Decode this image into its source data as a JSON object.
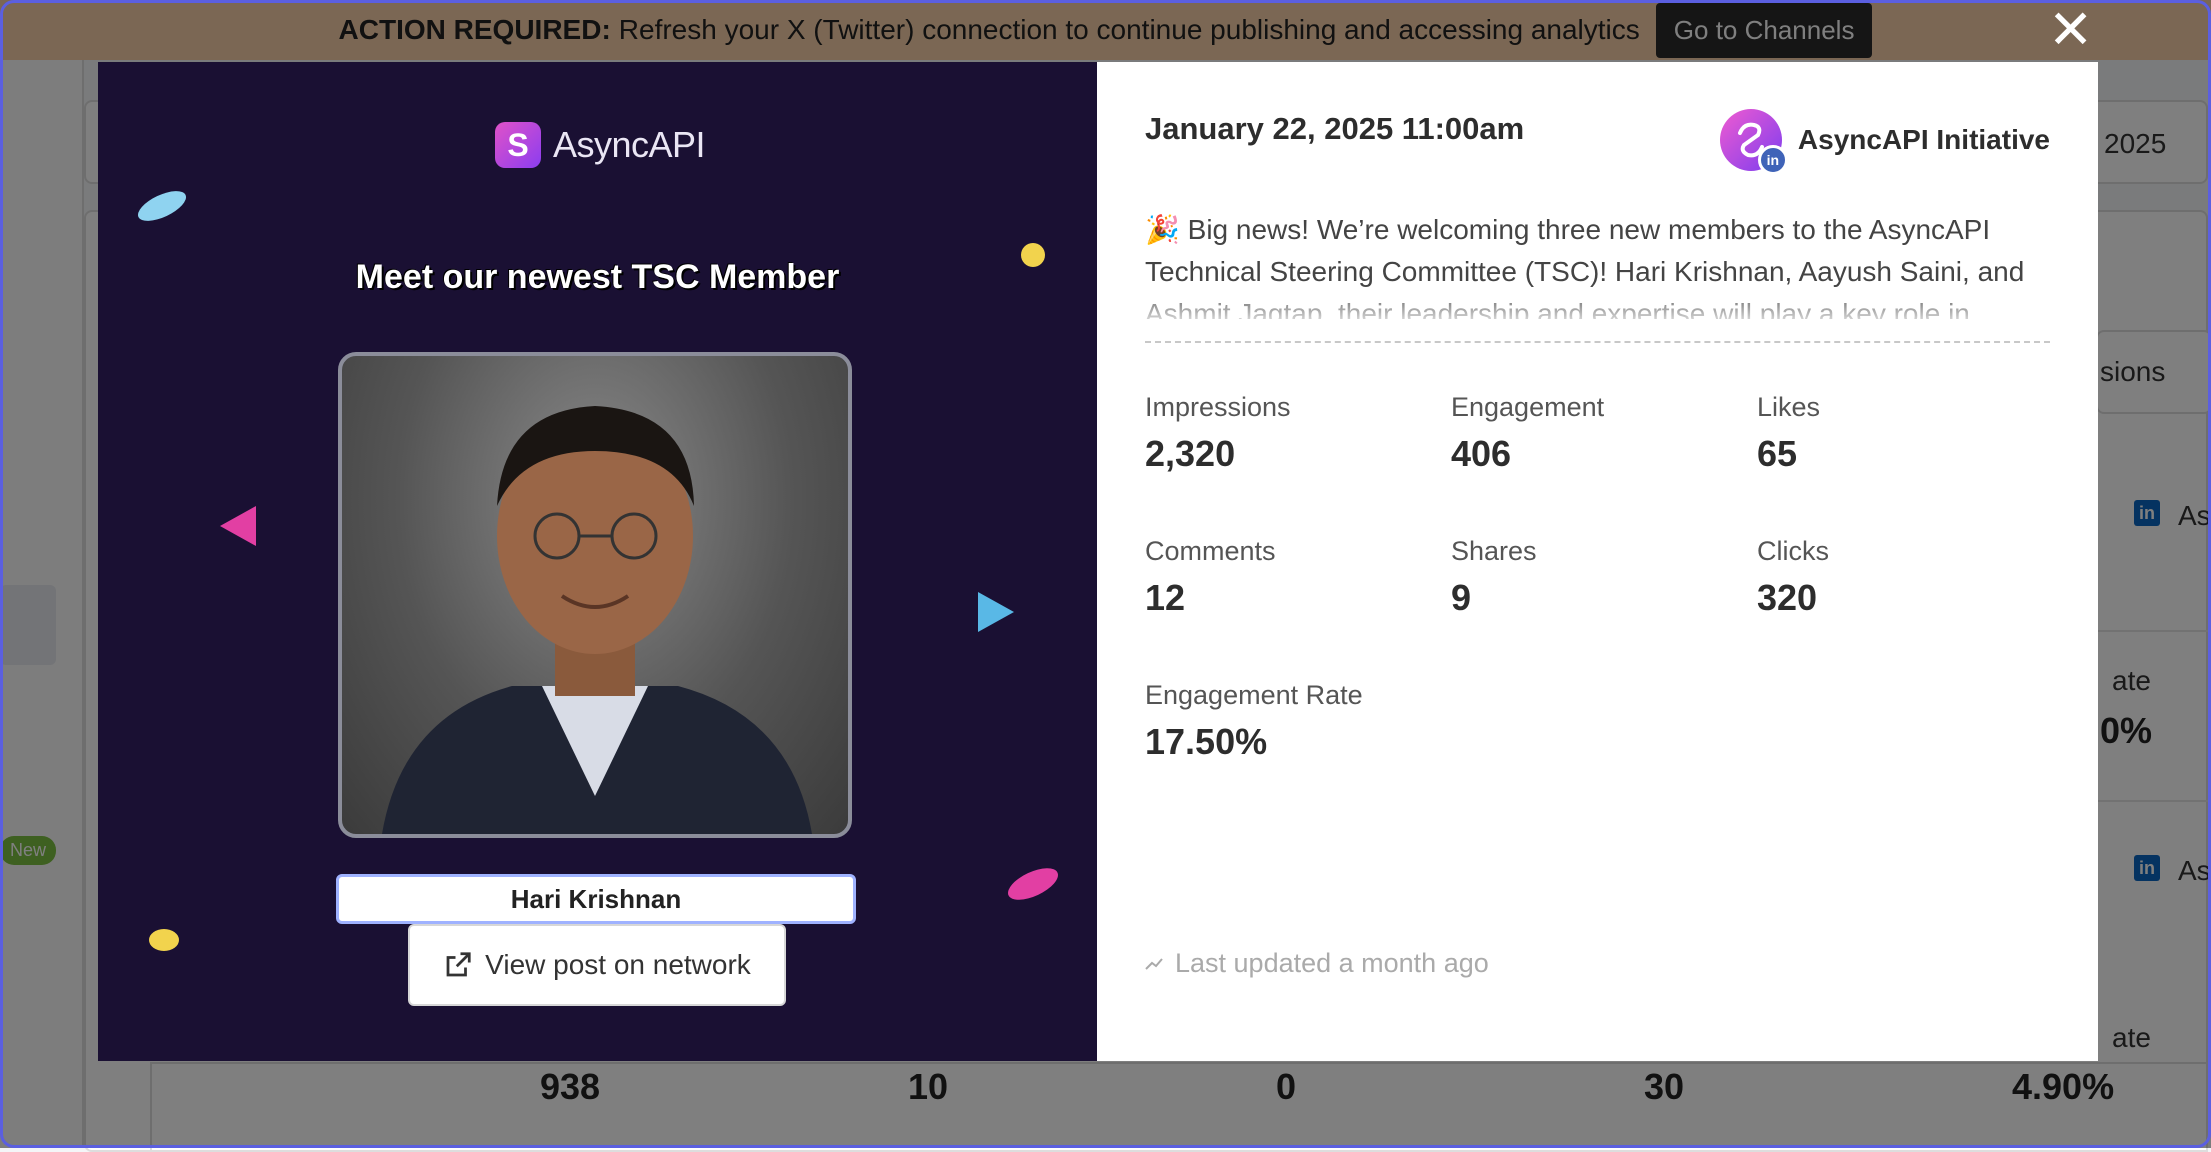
{
  "background": {
    "banner": {
      "prefix": "ACTION REQUIRED:",
      "message": "Refresh your X (Twitter) connection to continue publishing and accessing analytics",
      "button": "Go to Channels"
    },
    "year_fragment": "2025",
    "sort_fragment": "sions",
    "account_fragment_1": "As",
    "account_fragment_2": "As",
    "rate_label_1": "ate",
    "rate_value_1": "0%",
    "rate_label_2": "ate",
    "new_badge": "New",
    "bottom_row": [
      "938",
      "10",
      "0",
      "30",
      "4.90%"
    ]
  },
  "modal": {
    "close_label": "✕",
    "graphic": {
      "brand_mark": "S",
      "brand_name": "AsyncAPI",
      "title": "Meet our newest TSC Member",
      "member_name": "Hari Krishnan"
    },
    "view_post_label": "View post on network",
    "post": {
      "date": "January 22, 2025 11:00am",
      "account_name": "AsyncAPI Initiative",
      "network_badge": "in",
      "body": "🎉 Big news! We’re welcoming three new members to the AsyncAPI Technical Steering Committee (TSC)! Hari Krishnan, Aayush Saini, and Ashmit Jagtap, their leadership and expertise will play a key role in"
    },
    "metrics": [
      {
        "label": "Impressions",
        "value": "2,320"
      },
      {
        "label": "Engagement",
        "value": "406"
      },
      {
        "label": "Likes",
        "value": "65"
      },
      {
        "label": "Comments",
        "value": "12"
      },
      {
        "label": "Shares",
        "value": "9"
      },
      {
        "label": "Clicks",
        "value": "320"
      },
      {
        "label": "Engagement Rate",
        "value": "17.50%"
      }
    ],
    "last_updated": "Last updated a month ago"
  },
  "colors": {
    "overlay_frame": "#5b5fe0",
    "graphic_bg": "#1a1033",
    "banner_bg": "#f6cfa9",
    "brand_gradient_start": "#e052c8",
    "brand_gradient_end": "#8b3df0",
    "linkedin": "#3f63b8"
  }
}
